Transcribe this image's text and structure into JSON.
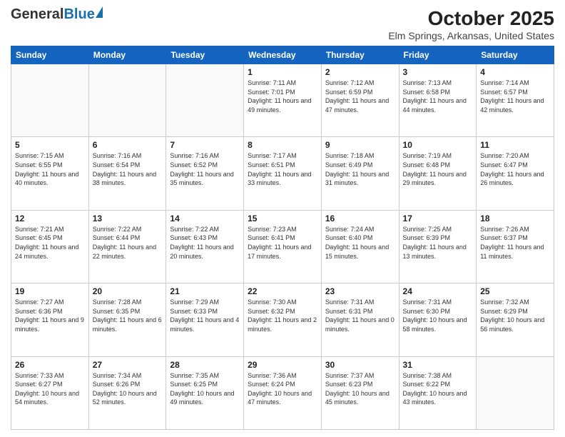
{
  "header": {
    "logo_general": "General",
    "logo_blue": "Blue",
    "title": "October 2025",
    "subtitle": "Elm Springs, Arkansas, United States"
  },
  "days_of_week": [
    "Sunday",
    "Monday",
    "Tuesday",
    "Wednesday",
    "Thursday",
    "Friday",
    "Saturday"
  ],
  "weeks": [
    [
      {
        "num": "",
        "info": ""
      },
      {
        "num": "",
        "info": ""
      },
      {
        "num": "",
        "info": ""
      },
      {
        "num": "1",
        "info": "Sunrise: 7:11 AM\nSunset: 7:01 PM\nDaylight: 11 hours\nand 49 minutes."
      },
      {
        "num": "2",
        "info": "Sunrise: 7:12 AM\nSunset: 6:59 PM\nDaylight: 11 hours\nand 47 minutes."
      },
      {
        "num": "3",
        "info": "Sunrise: 7:13 AM\nSunset: 6:58 PM\nDaylight: 11 hours\nand 44 minutes."
      },
      {
        "num": "4",
        "info": "Sunrise: 7:14 AM\nSunset: 6:57 PM\nDaylight: 11 hours\nand 42 minutes."
      }
    ],
    [
      {
        "num": "5",
        "info": "Sunrise: 7:15 AM\nSunset: 6:55 PM\nDaylight: 11 hours\nand 40 minutes."
      },
      {
        "num": "6",
        "info": "Sunrise: 7:16 AM\nSunset: 6:54 PM\nDaylight: 11 hours\nand 38 minutes."
      },
      {
        "num": "7",
        "info": "Sunrise: 7:16 AM\nSunset: 6:52 PM\nDaylight: 11 hours\nand 35 minutes."
      },
      {
        "num": "8",
        "info": "Sunrise: 7:17 AM\nSunset: 6:51 PM\nDaylight: 11 hours\nand 33 minutes."
      },
      {
        "num": "9",
        "info": "Sunrise: 7:18 AM\nSunset: 6:49 PM\nDaylight: 11 hours\nand 31 minutes."
      },
      {
        "num": "10",
        "info": "Sunrise: 7:19 AM\nSunset: 6:48 PM\nDaylight: 11 hours\nand 29 minutes."
      },
      {
        "num": "11",
        "info": "Sunrise: 7:20 AM\nSunset: 6:47 PM\nDaylight: 11 hours\nand 26 minutes."
      }
    ],
    [
      {
        "num": "12",
        "info": "Sunrise: 7:21 AM\nSunset: 6:45 PM\nDaylight: 11 hours\nand 24 minutes."
      },
      {
        "num": "13",
        "info": "Sunrise: 7:22 AM\nSunset: 6:44 PM\nDaylight: 11 hours\nand 22 minutes."
      },
      {
        "num": "14",
        "info": "Sunrise: 7:22 AM\nSunset: 6:43 PM\nDaylight: 11 hours\nand 20 minutes."
      },
      {
        "num": "15",
        "info": "Sunrise: 7:23 AM\nSunset: 6:41 PM\nDaylight: 11 hours\nand 17 minutes."
      },
      {
        "num": "16",
        "info": "Sunrise: 7:24 AM\nSunset: 6:40 PM\nDaylight: 11 hours\nand 15 minutes."
      },
      {
        "num": "17",
        "info": "Sunrise: 7:25 AM\nSunset: 6:39 PM\nDaylight: 11 hours\nand 13 minutes."
      },
      {
        "num": "18",
        "info": "Sunrise: 7:26 AM\nSunset: 6:37 PM\nDaylight: 11 hours\nand 11 minutes."
      }
    ],
    [
      {
        "num": "19",
        "info": "Sunrise: 7:27 AM\nSunset: 6:36 PM\nDaylight: 11 hours\nand 9 minutes."
      },
      {
        "num": "20",
        "info": "Sunrise: 7:28 AM\nSunset: 6:35 PM\nDaylight: 11 hours\nand 6 minutes."
      },
      {
        "num": "21",
        "info": "Sunrise: 7:29 AM\nSunset: 6:33 PM\nDaylight: 11 hours\nand 4 minutes."
      },
      {
        "num": "22",
        "info": "Sunrise: 7:30 AM\nSunset: 6:32 PM\nDaylight: 11 hours\nand 2 minutes."
      },
      {
        "num": "23",
        "info": "Sunrise: 7:31 AM\nSunset: 6:31 PM\nDaylight: 11 hours\nand 0 minutes."
      },
      {
        "num": "24",
        "info": "Sunrise: 7:31 AM\nSunset: 6:30 PM\nDaylight: 10 hours\nand 58 minutes."
      },
      {
        "num": "25",
        "info": "Sunrise: 7:32 AM\nSunset: 6:29 PM\nDaylight: 10 hours\nand 56 minutes."
      }
    ],
    [
      {
        "num": "26",
        "info": "Sunrise: 7:33 AM\nSunset: 6:27 PM\nDaylight: 10 hours\nand 54 minutes."
      },
      {
        "num": "27",
        "info": "Sunrise: 7:34 AM\nSunset: 6:26 PM\nDaylight: 10 hours\nand 52 minutes."
      },
      {
        "num": "28",
        "info": "Sunrise: 7:35 AM\nSunset: 6:25 PM\nDaylight: 10 hours\nand 49 minutes."
      },
      {
        "num": "29",
        "info": "Sunrise: 7:36 AM\nSunset: 6:24 PM\nDaylight: 10 hours\nand 47 minutes."
      },
      {
        "num": "30",
        "info": "Sunrise: 7:37 AM\nSunset: 6:23 PM\nDaylight: 10 hours\nand 45 minutes."
      },
      {
        "num": "31",
        "info": "Sunrise: 7:38 AM\nSunset: 6:22 PM\nDaylight: 10 hours\nand 43 minutes."
      },
      {
        "num": "",
        "info": ""
      }
    ]
  ]
}
